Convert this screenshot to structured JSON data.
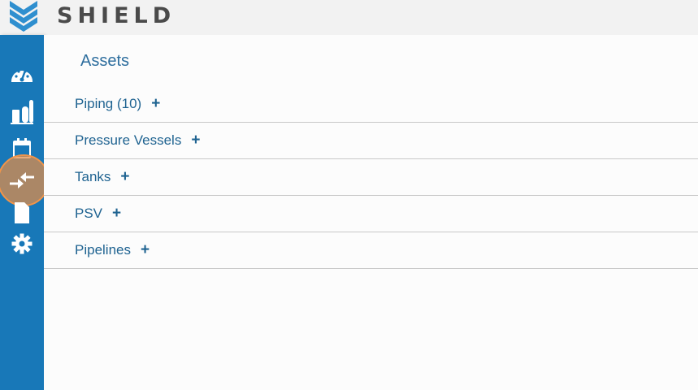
{
  "brand": {
    "name": "SHIELD"
  },
  "colors": {
    "sidebar": "#1878b8",
    "accent": "#1f6391",
    "highlight": "#f0944a"
  },
  "sidebar": {
    "items": [
      {
        "icon": "dashboard-gauge-icon"
      },
      {
        "icon": "facility-icon"
      },
      {
        "icon": "calendar-icon"
      },
      {
        "icon": "transfer-arrows-icon",
        "active": true
      },
      {
        "icon": "document-icon"
      },
      {
        "icon": "settings-gear-icon"
      }
    ]
  },
  "main": {
    "title": "Assets",
    "assets": [
      {
        "label": "Piping (10)",
        "add": "+"
      },
      {
        "label": "Pressure Vessels",
        "add": "+"
      },
      {
        "label": "Tanks",
        "add": "+"
      },
      {
        "label": "PSV",
        "add": "+"
      },
      {
        "label": "Pipelines",
        "add": "+"
      }
    ]
  }
}
